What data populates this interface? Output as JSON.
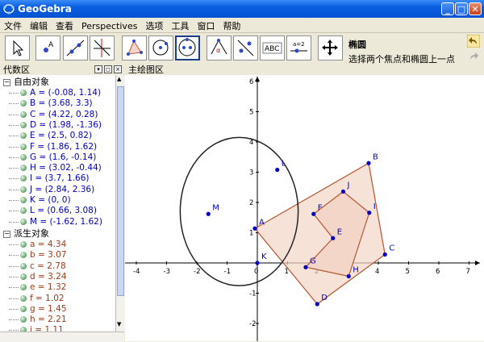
{
  "window": {
    "title": "GeoGebra",
    "min": "_",
    "max": "□",
    "close": "✕"
  },
  "menu": [
    "文件",
    "编辑",
    "查看",
    "Perspectives",
    "选项",
    "工具",
    "窗口",
    "帮助"
  ],
  "toolbar": {
    "tools": [
      "move",
      "point",
      "line",
      "perpendicular",
      "polygon",
      "circle",
      "conic",
      "angle",
      "reflect",
      "text",
      "slider",
      "move-view"
    ],
    "selected": "conic",
    "tool_name": "椭圆",
    "tool_desc": "选择两个焦点和椭圆上一点",
    "text_tool_label": "ABC",
    "slider_tool_label": "a=2"
  },
  "algebra": {
    "title": "代数区",
    "free_header": "自由对象",
    "dep_header": "派生对象",
    "free": [
      "A = (-0.08, 1.14)",
      "B = (3.68, 3.3)",
      "C = (4.22, 0.28)",
      "D = (1.98, -1.36)",
      "E = (2.5, 0.82)",
      "F = (1.86, 1.62)",
      "G = (1.6, -0.14)",
      "H = (3.02, -0.44)",
      "I = (3.7, 1.66)",
      "J = (2.84, 2.36)",
      "K = (0, 0)",
      "L = (0.66, 3.08)",
      "M = (-1.62, 1.62)"
    ],
    "dependent": [
      "a = 4.34",
      "b = 3.07",
      "c = 2.78",
      "d = 3.24",
      "e = 1.32",
      "f = 1.02",
      "g = 1.45",
      "h = 2.21",
      "i = 1.11"
    ]
  },
  "graphics": {
    "title": "主绘图区",
    "x_ticks": [
      "-4",
      "-3",
      "-2",
      "-1",
      "0",
      "1",
      "2",
      "3",
      "4",
      "5",
      "6",
      "7"
    ],
    "y_ticks": [
      "6",
      "5",
      "4",
      "3",
      "2",
      "1",
      "-1",
      "-2"
    ],
    "points": [
      {
        "name": "A",
        "x": -0.08,
        "y": 1.14
      },
      {
        "name": "B",
        "x": 3.68,
        "y": 3.3
      },
      {
        "name": "C",
        "x": 4.22,
        "y": 0.28
      },
      {
        "name": "D",
        "x": 1.98,
        "y": -1.36
      },
      {
        "name": "E",
        "x": 2.5,
        "y": 0.82
      },
      {
        "name": "F",
        "x": 1.86,
        "y": 1.62
      },
      {
        "name": "G",
        "x": 1.6,
        "y": -0.14
      },
      {
        "name": "H",
        "x": 3.02,
        "y": -0.44
      },
      {
        "name": "I",
        "x": 3.7,
        "y": 1.66
      },
      {
        "name": "J",
        "x": 2.84,
        "y": 2.36
      },
      {
        "name": "K",
        "x": 0,
        "y": 0
      },
      {
        "name": "L",
        "x": 0.66,
        "y": 3.08
      },
      {
        "name": "M",
        "x": -1.62,
        "y": 1.62
      }
    ],
    "polygon_outer": [
      "A",
      "B",
      "C",
      "D"
    ],
    "polygon_inner": [
      "F",
      "J",
      "I",
      "H",
      "G",
      "E"
    ],
    "colors": {
      "point": "#0000c0",
      "polygon_stroke": "#b4562f",
      "polygon_fill": "#f3d6c8",
      "ellipse": "#222222"
    }
  }
}
